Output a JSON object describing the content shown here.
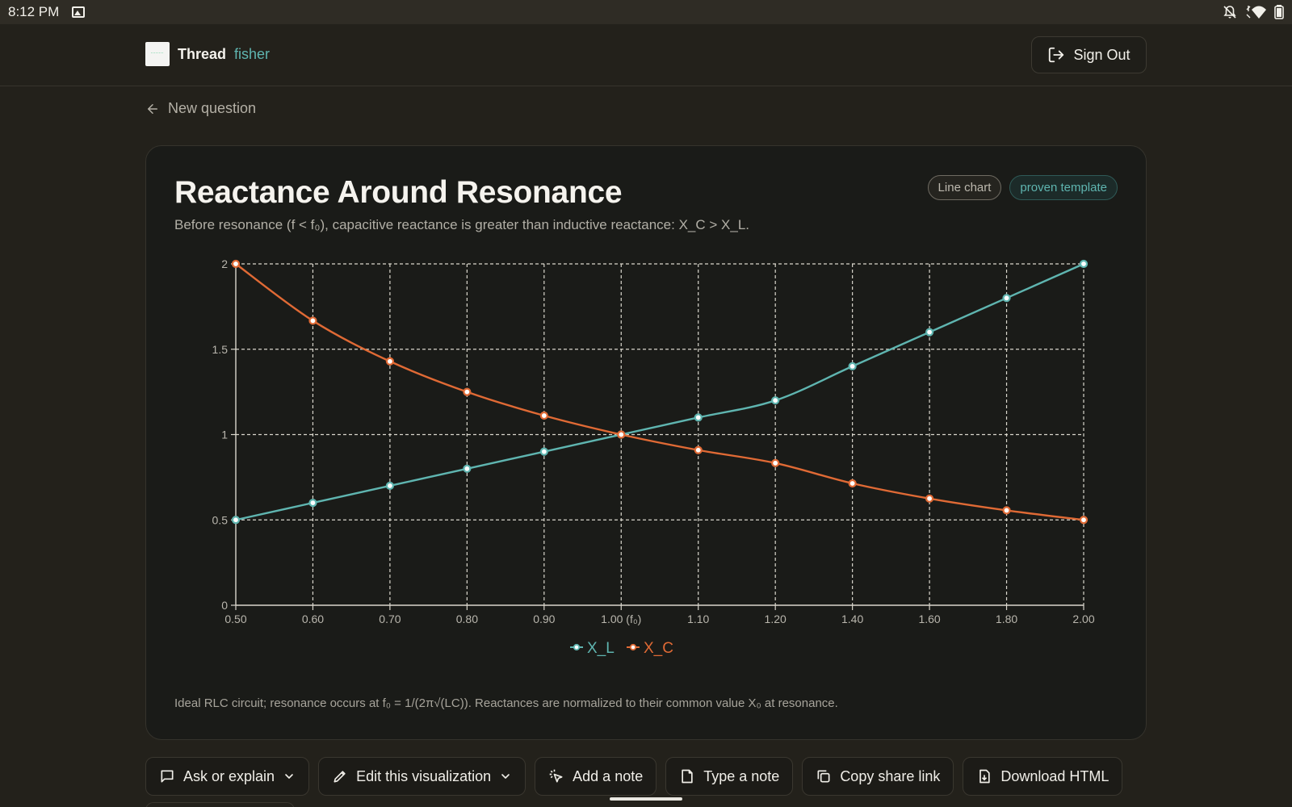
{
  "status_bar": {
    "time": "8:12 PM",
    "icons": [
      "gallery-icon",
      "notifications-off-icon",
      "wifi-icon",
      "battery-icon"
    ]
  },
  "header": {
    "app_name": "Thread",
    "username": "fisher",
    "sign_out_label": "Sign Out"
  },
  "back_link": {
    "label": "New question"
  },
  "card": {
    "title": "Reactance Around Resonance",
    "subtitle": "Before resonance (f < f₀), capacitive reactance is greater than inductive reactance: X_C > X_L.",
    "badge_type": "Line chart",
    "badge_template": "proven template",
    "note": "Ideal RLC circuit; resonance occurs at f₀ = 1/(2π√(LC)). Reactances are normalized to their common value X₀ at resonance."
  },
  "colors": {
    "accent": "#5fb5b0",
    "series_xl": "#5fb5b0",
    "series_xc": "#e06a35",
    "background": "#23211b",
    "card": "#1a1b18"
  },
  "chart_data": {
    "type": "line",
    "categories": [
      "0.50",
      "0.60",
      "0.70",
      "0.80",
      "0.90",
      "1.00 (f₀)",
      "1.10",
      "1.20",
      "1.40",
      "1.60",
      "1.80",
      "2.00"
    ],
    "series": [
      {
        "name": "X_L",
        "values": [
          0.5,
          0.6,
          0.7,
          0.8,
          0.9,
          1.0,
          1.1,
          1.2,
          1.4,
          1.6,
          1.8,
          2.0
        ]
      },
      {
        "name": "X_C",
        "values": [
          2.0,
          1.667,
          1.429,
          1.25,
          1.111,
          1.0,
          0.909,
          0.833,
          0.714,
          0.625,
          0.556,
          0.5
        ]
      }
    ],
    "ylim": [
      0,
      2
    ],
    "yticks": [
      "0",
      "0.5",
      "1",
      "1.5",
      "2"
    ],
    "ytick_values": [
      0,
      0.5,
      1,
      1.5,
      2
    ],
    "grid": true,
    "legend_position": "bottom-center"
  },
  "actions": [
    {
      "label": "Ask or explain",
      "icon": "chat-icon",
      "dropdown": true
    },
    {
      "label": "Edit this visualization",
      "icon": "pencil-icon",
      "dropdown": true
    },
    {
      "label": "Add a note",
      "icon": "pointer-click-icon",
      "dropdown": false
    },
    {
      "label": "Type a note",
      "icon": "note-icon",
      "dropdown": false
    },
    {
      "label": "Copy share link",
      "icon": "copy-icon",
      "dropdown": false
    },
    {
      "label": "Download HTML",
      "icon": "download-file-icon",
      "dropdown": false
    }
  ]
}
